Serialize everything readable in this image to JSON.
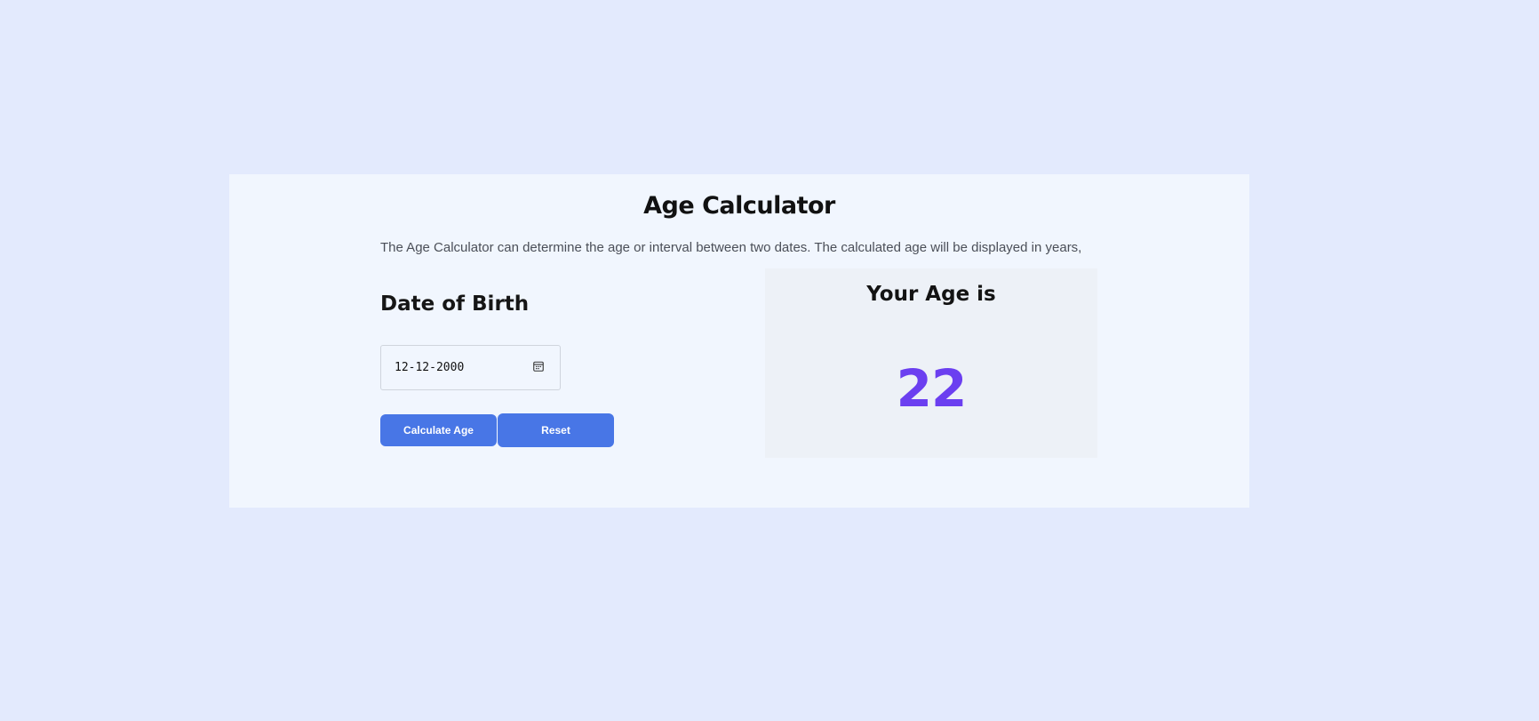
{
  "app": {
    "title": "Age Calculator",
    "description": "The Age Calculator can determine the age or interval between two dates. The calculated age will be displayed in years,"
  },
  "form": {
    "dob_label": "Date of Birth",
    "date_value": "12-12-2000",
    "calendar_icon": "calendar-icon",
    "calculate_label": "Calculate Age",
    "reset_label": "Reset"
  },
  "result": {
    "heading": "Your Age is",
    "age": "22"
  },
  "colors": {
    "page_background": "#e3eafd",
    "card_background": "#f1f6fe",
    "result_background": "#edf1f7",
    "button": "#4876e6",
    "accent": "#6b3ff0"
  }
}
